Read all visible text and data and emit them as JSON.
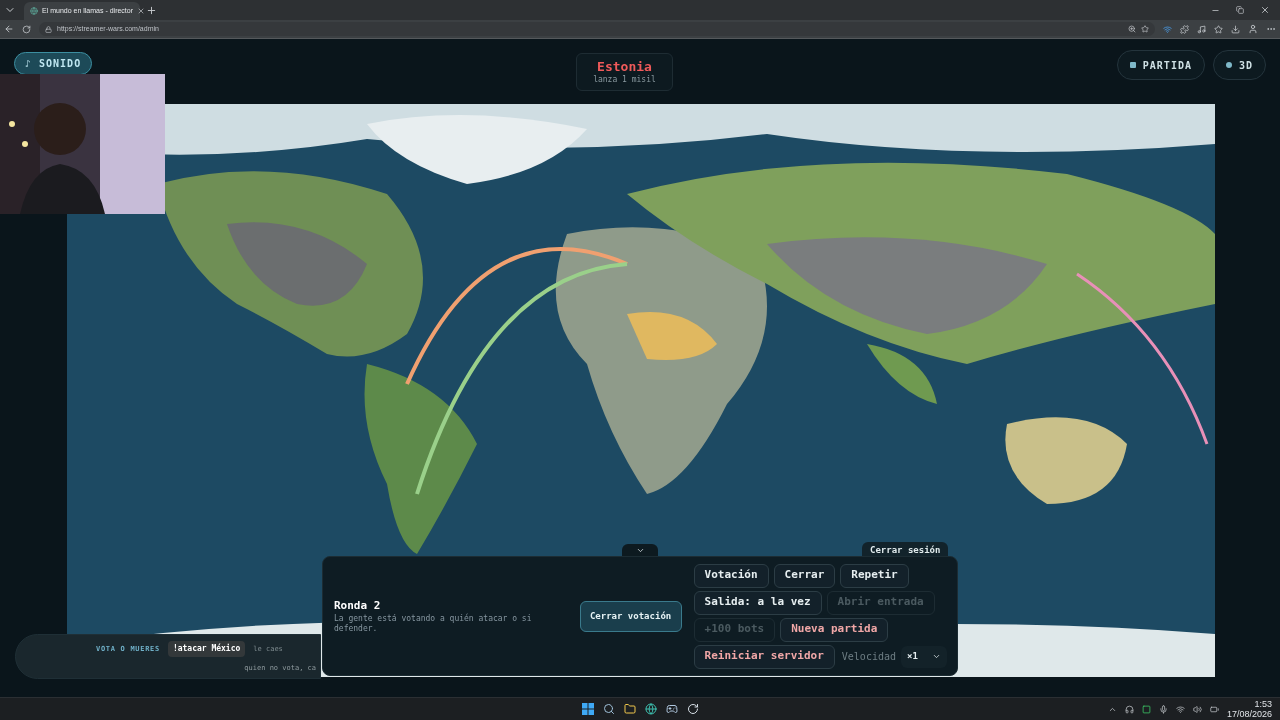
{
  "browser": {
    "tab_title": "El mundo en llamas - director",
    "url": "https://streamer-wars.com/admin"
  },
  "header": {
    "sound_button": "♪ SONIDO",
    "turn": {
      "country": "Estonia",
      "action": "lanza 1 misil"
    },
    "right_buttons": [
      {
        "label": "PARTIDA",
        "kind": "square"
      },
      {
        "label": "3D",
        "kind": "dot"
      }
    ]
  },
  "logout_button": "Cerrar sesión",
  "round_panel": {
    "title": "Ronda 2",
    "description": "La gente está votando a quién atacar o si defender.",
    "primary_button": "Cerrar votación",
    "button_rows": [
      {
        "buttons": [
          {
            "label": "Votación",
            "kind": "normal",
            "disabled": false
          },
          {
            "label": "Cerrar",
            "kind": "normal",
            "disabled": false
          },
          {
            "label": "Repetir",
            "kind": "normal",
            "disabled": false
          }
        ]
      },
      {
        "buttons": [
          {
            "label": "Salida: a la vez",
            "kind": "normal",
            "disabled": false
          },
          {
            "label": "Abrir entrada",
            "kind": "normal",
            "disabled": true
          }
        ]
      },
      {
        "buttons": [
          {
            "label": "+100 bots",
            "kind": "normal",
            "disabled": true
          },
          {
            "label": "Nueva partida",
            "kind": "danger",
            "disabled": false
          }
        ]
      },
      {
        "buttons": [
          {
            "label": "Reiniciar servidor",
            "kind": "danger",
            "disabled": false
          }
        ]
      }
    ],
    "speed": {
      "label": "Velocidad",
      "value": "×1"
    }
  },
  "vote_strip": {
    "heading": "VOTA O MUERES",
    "command": "!atacar México",
    "hint": "le caes",
    "footer": "quien no vota, ca"
  },
  "taskbar": {
    "time": "1:53",
    "date": "17/08/2026"
  }
}
